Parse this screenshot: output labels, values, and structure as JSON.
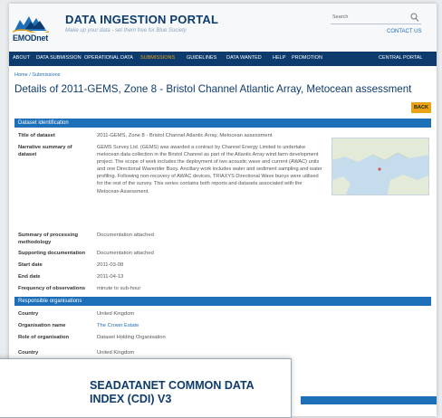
{
  "header": {
    "logo_text": "EMODnet",
    "title": "DATA INGESTION PORTAL",
    "tagline": "Make up your data - set them free for Blue Society",
    "search_label": "Search",
    "contact": "CONTACT US"
  },
  "nav": {
    "items": [
      "ABOUT",
      "DATA SUBMISSION",
      "OPERATIONAL DATA",
      "SUBMISSIONS",
      "GUIDELINES",
      "DATA WANTED",
      "HELP",
      "PROMOTION",
      "CENTRAL PORTAL"
    ],
    "active": "SUBMISSIONS"
  },
  "breadcrumb": "Home / Submissions",
  "page_title": "Details of 2011-GEMS, Zone 8 - Bristol Channel Atlantic Array, Metocean assessment",
  "back_label": "BACK",
  "dataset": {
    "section": "Dataset identification",
    "title_label": "Title of dataset",
    "title_value": "2011-GEMS, Zone 8 - Bristol Channel Atlantic Array, Metocean assessment",
    "narrative_label": "Narrative summary of dataset",
    "narrative_value": "GEMS Survey Ltd. (GEMS) was awarded a contract by Channel Energy Limited to undertake metocean data collection in the Bristol Channel as part of the Atlantic Array wind farm development project. The scope of work includes the deployment of two acoustic wave and current (AWAC) units and one Directional Waverider Buoy. Ancillary work includes water and sediment sampling and water profiling. Following non-recovery of AWAC devices, TRIAXYS Directional Wave buoys were utilised for the rest of the survey. This series contains both reports and datasets associated with the Metocean Assessment.",
    "processing_label": "Summary of processing methodology",
    "processing_value": "Documentation attached",
    "docs_label": "Supporting documentation",
    "docs_value": "Documentation attached",
    "start_label": "Start date",
    "start_value": "2011-03-08",
    "end_label": "End date",
    "end_value": "2011-04-13",
    "freq_label": "Frequency of observations",
    "freq_value": "minute to sub-hour"
  },
  "organisations": {
    "section": "Responsible organisations",
    "country_label": "Country",
    "country_value": "United Kingdom",
    "name_label": "Organisation name",
    "name_value": "The Crown Estate",
    "role_label": "Role of organisation",
    "role_value": "Dataset Holding Organisation",
    "country2_label": "Country",
    "country2_value": "United Kingdom"
  },
  "cdi_title": "SEADATANET COMMON DATA INDEX (CDI) V3",
  "colors": {
    "navy": "#0d3b6e",
    "blue": "#1d6fb8",
    "accent": "#e8a317"
  }
}
